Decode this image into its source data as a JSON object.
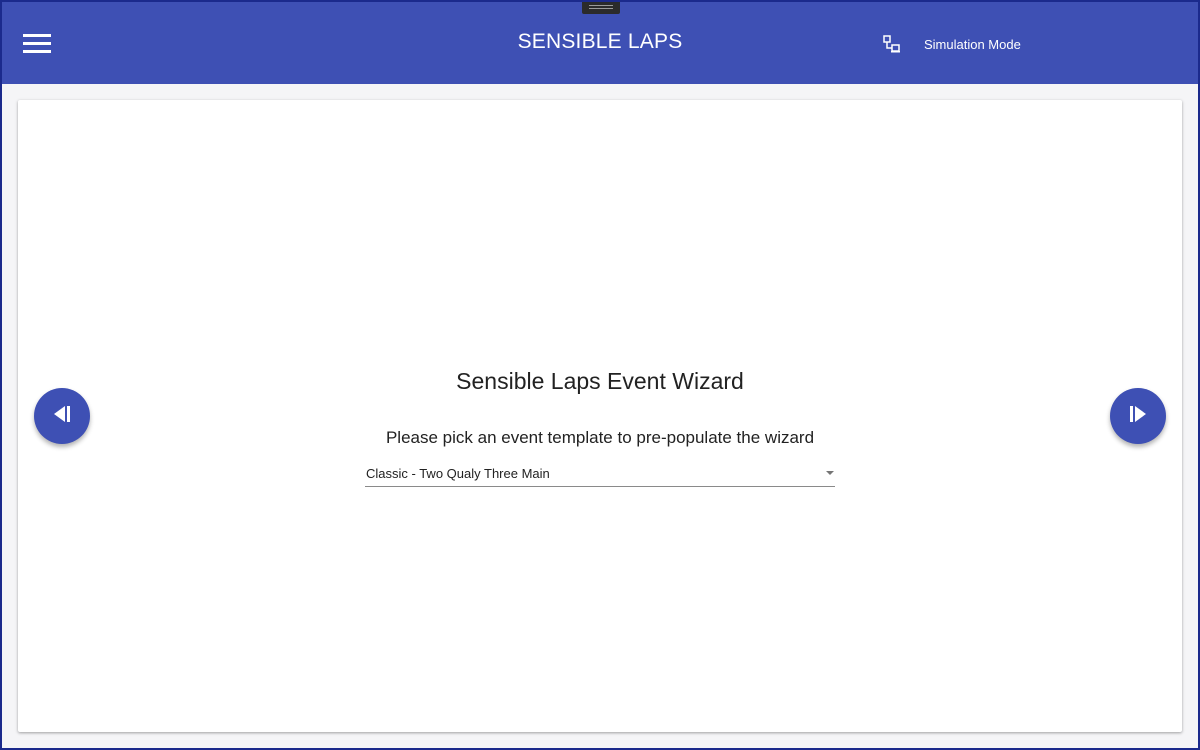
{
  "header": {
    "title": "SENSIBLE LAPS",
    "menu_icon": "hamburger-menu-icon",
    "mode_icon": "network-icon",
    "mode_label": "Simulation Mode"
  },
  "wizard": {
    "title": "Sensible Laps Event Wizard",
    "prompt": "Please pick an event template to pre-populate the wizard",
    "template_select": {
      "selected": "Classic - Two Qualy Three Main"
    },
    "prev_icon": "skip-previous-icon",
    "next_icon": "skip-next-icon"
  },
  "colors": {
    "primary": "#3e50b4",
    "window_border": "#1b2a8c",
    "background": "#f5f5f7",
    "card": "#ffffff",
    "text": "#222222"
  }
}
